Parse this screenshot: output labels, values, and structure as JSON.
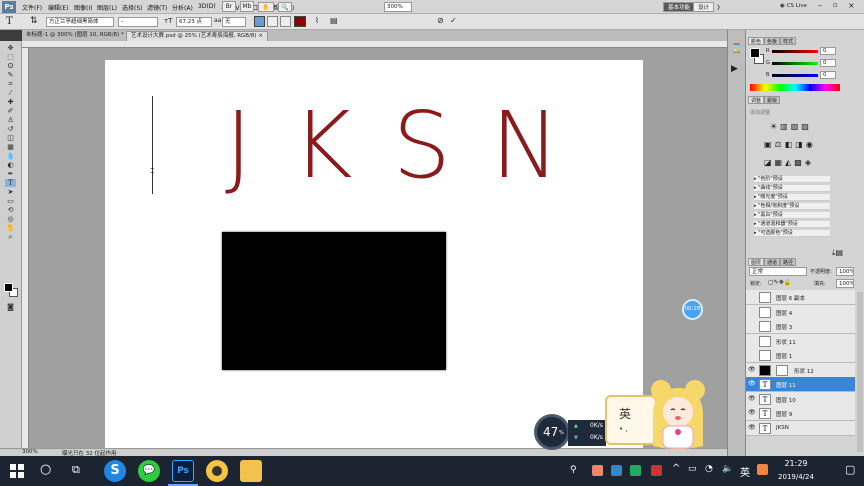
{
  "app": {
    "logo": "Ps",
    "workspace_label": "基本功能",
    "design_label": "设计",
    "more_label": "》",
    "search_label": "CS Live"
  },
  "menu": [
    "文件(F)",
    "编辑(E)",
    "图像(I)",
    "图层(L)",
    "选择(S)",
    "滤镜(T)",
    "分析(A)",
    "3D(D)",
    "视图(V)",
    "窗口(W)",
    "帮助(H)"
  ],
  "menu_extra": {
    "zoom": "300%"
  },
  "options": {
    "font_family": "方正兰亭超细黑简体",
    "font_style": "-",
    "font_size": "67.23 点",
    "aa_mode": "无",
    "text_color": "#8b0000"
  },
  "tabs": [
    {
      "label": "未标题-1 @ 300% (图层 10, RGB/8) *",
      "active": false
    },
    {
      "label": "艺术设计大赛.psd @ 25% (艺术寿辰海报, RGB/8)",
      "active": true
    }
  ],
  "canvas": {
    "text": "JKSN",
    "text_color": "#8b1a1a",
    "rect_color": "#000000"
  },
  "status": {
    "zoom": "300%",
    "info": "曝光只在 32 位起作用"
  },
  "color_panel": {
    "tabs": [
      "颜色",
      "色板",
      "样式"
    ],
    "r_label": "R",
    "g_label": "G",
    "b_label": "B",
    "r_value": "0",
    "g_value": "0",
    "b_value": "0"
  },
  "adjust_panel": {
    "tabs": [
      "调整",
      "蒙版"
    ],
    "title": "添加调整",
    "presets": [
      "\"色阶\"预设",
      "\"曲线\"预设",
      "\"曝光度\"预设",
      "\"色相/饱和度\"预设",
      "\"黑白\"预设",
      "\"通道混和器\"预设",
      "\"可选颜色\"预设"
    ]
  },
  "layers_panel": {
    "tabs": [
      "图层",
      "通道",
      "路径"
    ],
    "blend_mode": "正常",
    "opacity_label": "不透明度:",
    "opacity": "100%",
    "lock_label": "锁定:",
    "fill_label": "填充:",
    "fill": "100%",
    "layers": [
      {
        "name": "图层 6 副本",
        "thumb": "",
        "selected": false,
        "visible": false
      },
      {
        "name": "图层 4",
        "thumb": "",
        "selected": false,
        "visible": false
      },
      {
        "name": "图层 3",
        "thumb": "",
        "selected": false,
        "visible": false
      },
      {
        "name": "形状 11",
        "thumb": "",
        "selected": false,
        "visible": false
      },
      {
        "name": "图层 1",
        "thumb": "",
        "selected": false,
        "visible": false
      },
      {
        "name": "形状 12",
        "thumb": "",
        "selected": false,
        "visible": true
      },
      {
        "name": "图层 11",
        "thumb": "T",
        "selected": true,
        "visible": true
      },
      {
        "name": "图层 10",
        "thumb": "T",
        "selected": false,
        "visible": true
      },
      {
        "name": "图层 9",
        "thumb": "T",
        "selected": false,
        "visible": true
      },
      {
        "name": "JKSN",
        "thumb": "T",
        "selected": false,
        "visible": true
      }
    ]
  },
  "overlays": {
    "timer": "00:28",
    "cpu_percent": "47",
    "cpu_unit": "%",
    "net_up": "0K/s",
    "net_down": "0K/s",
    "ime_char": "英",
    "ime_punct": "• ,"
  },
  "taskbar": {
    "time": "21:29",
    "date": "2019/4/24",
    "ime": "英",
    "search_icon": "search-icon",
    "ps_label": "Ps"
  }
}
